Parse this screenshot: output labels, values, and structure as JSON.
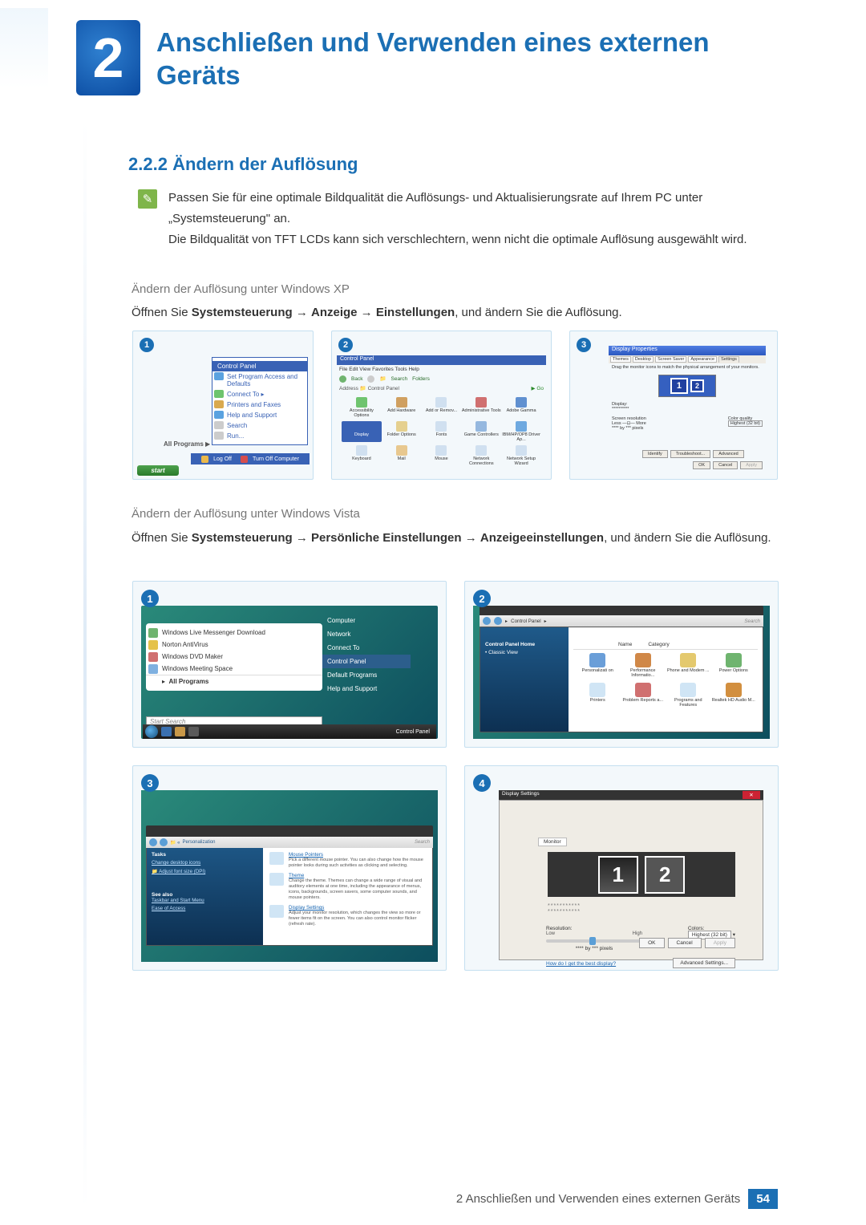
{
  "chapter": {
    "number": "2",
    "title": "Anschließen und Verwenden eines externen Geräts"
  },
  "section": {
    "number": "2.2.2",
    "title": "Ändern der Auflösung"
  },
  "intro": {
    "p1": "Passen Sie für eine optimale Bildqualität die Auflösungs- und Aktualisierungsrate auf Ihrem PC unter „Systemsteuerung\" an.",
    "p2": "Die Bildqualität von TFT LCDs kann sich verschlechtern, wenn nicht die optimale Auflösung ausgewählt wird."
  },
  "xp": {
    "heading": "Ändern der Auflösung unter Windows XP",
    "instruction_pre": "Öffnen Sie ",
    "path1": "Systemsteuerung",
    "arrow": " → ",
    "path2": "Anzeige",
    "path3": "Einstellungen",
    "instruction_post": ", und ändern Sie die Auflösung.",
    "box1": {
      "num": "1",
      "panel_title": "Control Panel",
      "items": [
        "Set Program Access and Defaults",
        "Connect To",
        "Printers and Faxes",
        "Help and Support",
        "Search",
        "Run..."
      ],
      "all_programs": "All Programs",
      "logoff": "Log Off",
      "turnoff": "Turn Off Computer",
      "start": "start"
    },
    "box2": {
      "num": "2",
      "title": "Control Panel",
      "menu": "File   Edit   View   Favorites   Tools   Help",
      "toolbar": {
        "back": "Back",
        "search": "Search",
        "folders": "Folders"
      },
      "address": "Control Panel",
      "icons": [
        "Accessibility Options",
        "Add Hardware",
        "Add or Remov...",
        "Administrative Tools",
        "Adobe Gamma",
        "Display",
        "Folder Options",
        "Fonts",
        "Game Controllers",
        "IBM/HP/OP8 Driver Ap...",
        "Keyboard",
        "Mail",
        "Mouse",
        "Network Connections",
        "Network Setup Wizard"
      ],
      "selected": "Display"
    },
    "box3": {
      "num": "3",
      "title": "Display Properties",
      "tabs": [
        "Themes",
        "Desktop",
        "Screen Saver",
        "Appearance",
        "Settings"
      ],
      "drag_text": "Drag the monitor icons to match the physical arrangement of your monitors.",
      "mon1": "1",
      "mon2": "2",
      "display": "Display:",
      "display_val": "**********",
      "screen_res": "Screen resolution",
      "less": "Less",
      "more": "More",
      "resval": "**** by *** pixels",
      "color_q": "Color quality",
      "color_v": "Highest (32 bit)",
      "buttons": [
        "Identify",
        "Troubleshoot...",
        "Advanced"
      ],
      "ok": "OK",
      "cancel": "Cancel",
      "apply": "Apply"
    }
  },
  "vista": {
    "heading": "Ändern der Auflösung unter Windows Vista",
    "instruction_pre": "Öffnen Sie ",
    "path1": "Systemsteuerung",
    "arrow": " → ",
    "path2": "Persönliche Einstellungen",
    "path3": "Anzeigeeinstellungen",
    "instruction_post": ", und ändern Sie die Auflösung.",
    "box1": {
      "num": "1",
      "left_items": [
        "Windows Live Messenger Download",
        "Norton AntiVirus",
        "Windows DVD Maker",
        "Windows Meeting Space",
        "All Programs"
      ],
      "right_items": [
        "Computer",
        "Network",
        "Connect To",
        "Control Panel",
        "Default Programs",
        "Help and Support"
      ],
      "highlight": "Control Panel",
      "search": "Start Search",
      "taskbar_label": "Control Panel"
    },
    "box2": {
      "num": "2",
      "breadcrumb": "Control Panel",
      "search": "Search",
      "side": {
        "home": "Control Panel Home",
        "classic": "Classic View"
      },
      "headers": [
        "Name",
        "Category"
      ],
      "icons": [
        "Personalizati on",
        "Performance Informatio...",
        "Phone and Modem ...",
        "Power Options",
        "Printers",
        "Problem Reports a...",
        "Programs and Features",
        "Realtek HD Audio M..."
      ]
    },
    "box3": {
      "num": "3",
      "breadcrumb": "Personalization",
      "search": "Search",
      "side": {
        "tasks": "Tasks",
        "icons": "Change desktop icons",
        "font": "Adjust font size (DPI)",
        "see_also": "See also",
        "taskbar": "Taskbar and Start Menu",
        "ease": "Ease of Access"
      },
      "items": [
        {
          "title": "Mouse Pointers",
          "desc": "Pick a different mouse pointer. You can also change how the mouse pointer looks during such activities as clicking and selecting."
        },
        {
          "title": "Theme",
          "desc": "Change the theme. Themes can change a wide range of visual and auditory elements at one time, including the appearance of menus, icons, backgrounds, screen savers, some computer sounds, and mouse pointers."
        },
        {
          "title": "Display Settings",
          "desc": "Adjust your monitor resolution, which changes the view so more or fewer items fit on the screen. You can also control monitor flicker (refresh rate)."
        }
      ]
    },
    "box4": {
      "num": "4",
      "title": "Display Settings",
      "tab": "Monitor",
      "mon1": "1",
      "mon2": "2",
      "dots1": "***********",
      "dots2": "***********",
      "resolution": "Resolution:",
      "low": "Low",
      "high": "High",
      "resval": "**** by *** pixels",
      "colors": "Colors:",
      "color_v": "Highest (32 bit)",
      "link": "How do I get the best display?",
      "adv": "Advanced Settings...",
      "ok": "OK",
      "cancel": "Cancel",
      "apply": "Apply"
    }
  },
  "footer": {
    "text": "2 Anschließen und Verwenden eines externen Geräts",
    "page": "54"
  }
}
